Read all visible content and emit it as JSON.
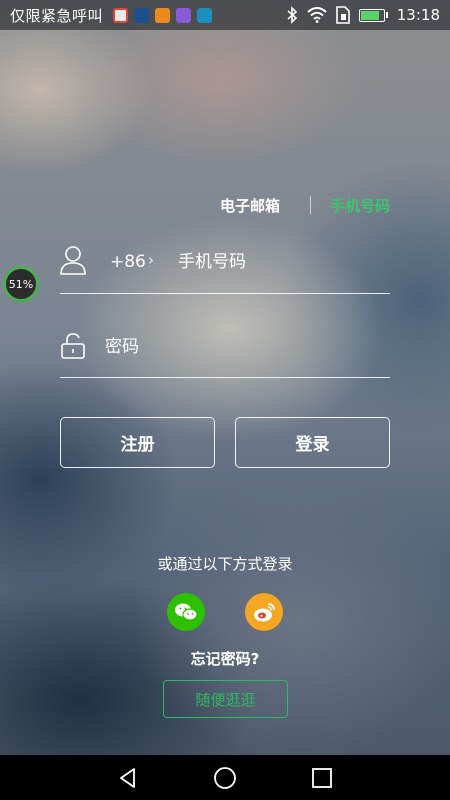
{
  "status_bar": {
    "carrier": "仅限紧急呼叫",
    "notification_icons": [
      {
        "name": "chrome-notif-icon",
        "color": "#e9e9e9"
      },
      {
        "name": "app-notif-icon-blue",
        "color": "#1d4f8f"
      },
      {
        "name": "app-notif-icon-orange",
        "color": "#e98b1f"
      },
      {
        "name": "app-notif-icon-purple",
        "color": "#8a5bd6"
      },
      {
        "name": "app-notif-icon-cyan",
        "color": "#1d8fbf"
      }
    ],
    "time": "13:18",
    "battery_level": 0.85
  },
  "tabs": {
    "email": "电子邮箱",
    "phone": "手机号码",
    "active": "phone"
  },
  "progress_badge": "51%",
  "phone_field": {
    "country_code": "+86",
    "chevron": "›",
    "placeholder": "手机号码"
  },
  "password_field": {
    "placeholder": "密码"
  },
  "buttons": {
    "register": "注册",
    "login": "登录"
  },
  "alt_login_label": "或通过以下方式登录",
  "social": [
    "wechat",
    "weibo"
  ],
  "forgot_password": "忘记密码?",
  "guest_button": "随便逛逛",
  "colors": {
    "accent_green": "#3ec46d",
    "wechat_green": "#2dc100",
    "weibo_orange": "#f5a623"
  }
}
